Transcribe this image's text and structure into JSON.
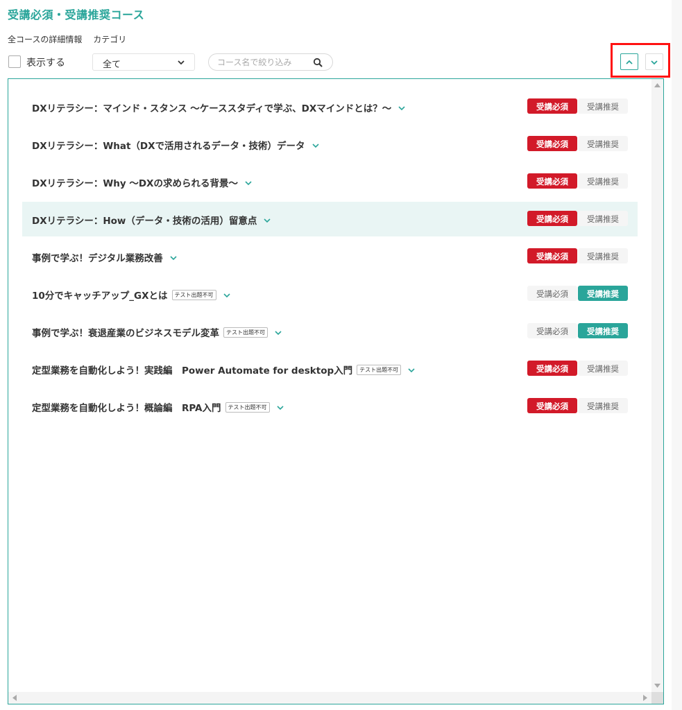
{
  "header": {
    "title": "受講必須・受講推奨コース",
    "subtabs": [
      "全コースの詳細情報",
      "カテゴリ"
    ]
  },
  "filters": {
    "show_label": "表示する",
    "select_value": "全て",
    "search_placeholder": "コース名で絞り込み"
  },
  "labels": {
    "required": "受講必須",
    "recommended": "受講推奨",
    "no_test": "テスト出題不可"
  },
  "colors": {
    "accent": "#2aa59a",
    "required": "#d21a29",
    "highlight": "#ff1111"
  },
  "courses": [
    {
      "title": "DXリテラシー：マインド・スタンス ～ケーススタディで学ぶ、DXマインドとは？～",
      "status": "required"
    },
    {
      "title": "DXリテラシー：What（DXで活用されるデータ・技術）データ",
      "status": "required"
    },
    {
      "title": "DXリテラシー：Why ～DXの求められる背景～",
      "status": "required"
    },
    {
      "title": "DXリテラシー：How（データ・技術の活用）留意点",
      "status": "required",
      "highlighted": true
    },
    {
      "title": "事例で学ぶ！デジタル業務改善",
      "status": "required"
    },
    {
      "title": "10分でキャッチアップ_GXとは",
      "status": "recommended",
      "no_test": true
    },
    {
      "title": "事例で学ぶ！衰退産業のビジネスモデル変革",
      "status": "recommended",
      "no_test": true
    },
    {
      "title": "定型業務を自動化しよう！実践編　Power Automate for desktop入門",
      "status": "required",
      "no_test": true
    },
    {
      "title": "定型業務を自動化しよう！概論編　RPA入門",
      "status": "required",
      "no_test": true
    }
  ]
}
